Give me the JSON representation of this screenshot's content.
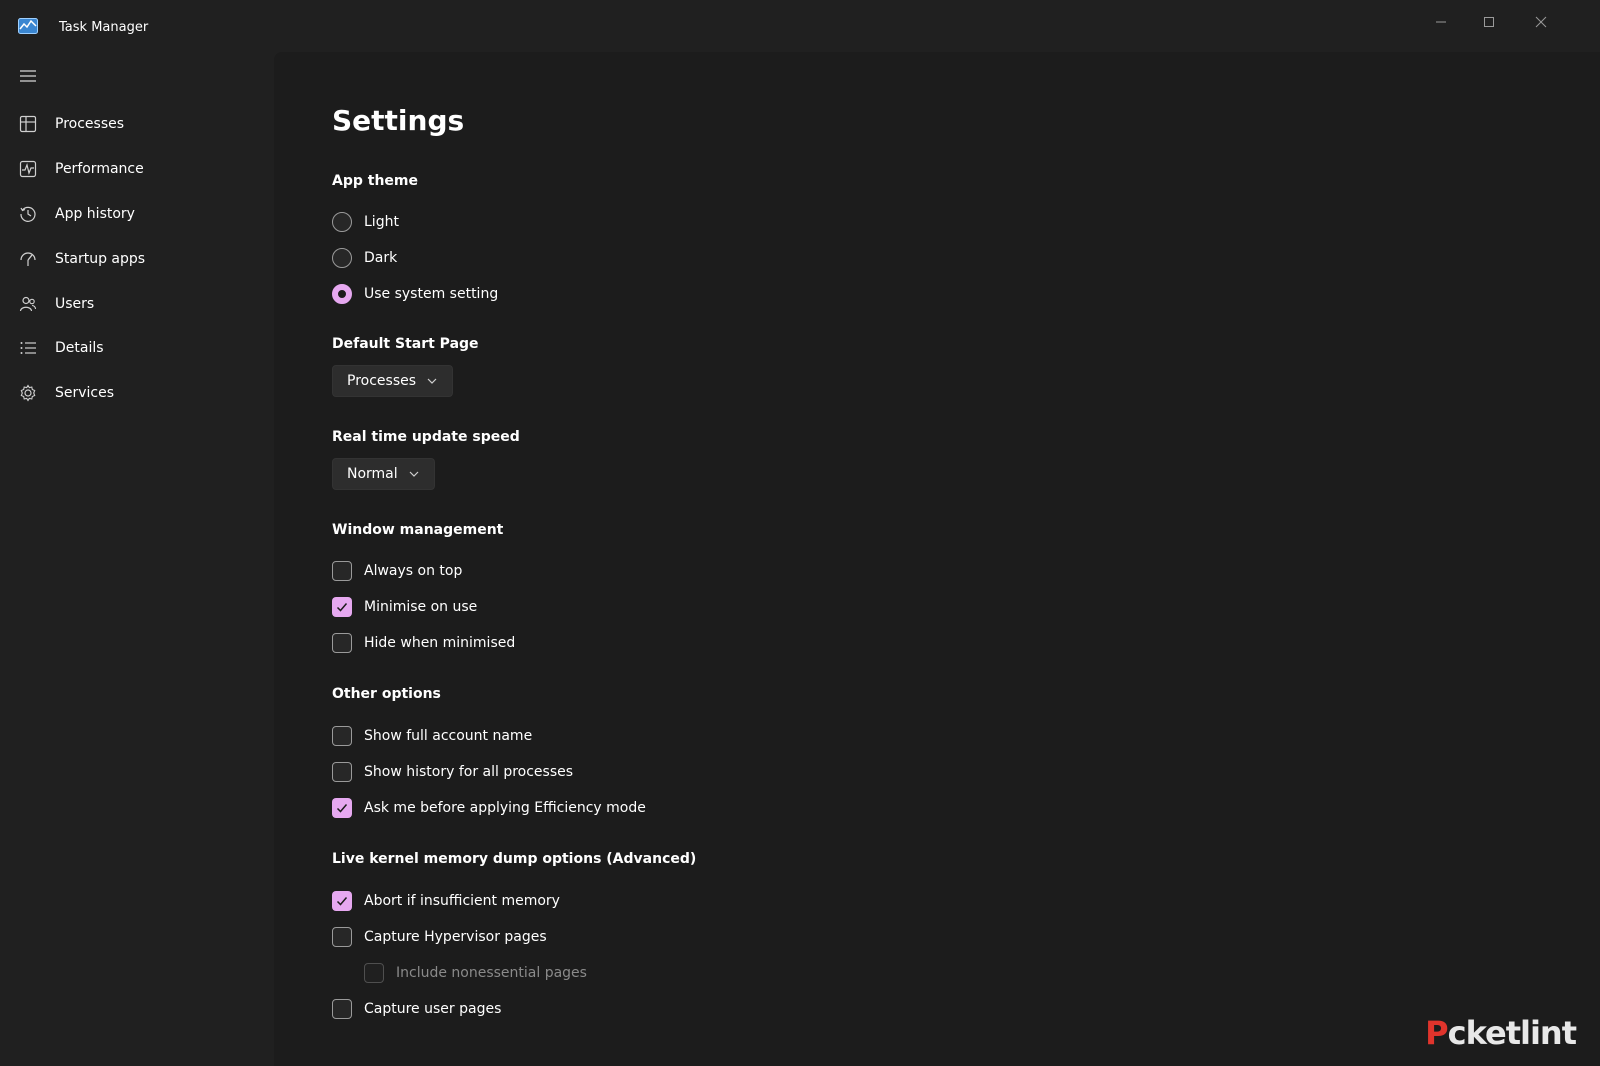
{
  "window": {
    "title": "Task Manager"
  },
  "sidebar": {
    "items": [
      {
        "label": "Processes",
        "icon": "processes-icon"
      },
      {
        "label": "Performance",
        "icon": "performance-icon"
      },
      {
        "label": "App history",
        "icon": "app-history-icon"
      },
      {
        "label": "Startup apps",
        "icon": "startup-apps-icon"
      },
      {
        "label": "Users",
        "icon": "users-icon"
      },
      {
        "label": "Details",
        "icon": "details-icon"
      },
      {
        "label": "Services",
        "icon": "services-icon"
      }
    ]
  },
  "settings": {
    "title": "Settings",
    "app_theme": {
      "heading": "App theme",
      "options": [
        {
          "label": "Light",
          "selected": false
        },
        {
          "label": "Dark",
          "selected": false
        },
        {
          "label": "Use system setting",
          "selected": true
        }
      ]
    },
    "default_start_page": {
      "heading": "Default Start Page",
      "value": "Processes"
    },
    "update_speed": {
      "heading": "Real time update speed",
      "value": "Normal"
    },
    "window_management": {
      "heading": "Window management",
      "options": [
        {
          "label": "Always on top",
          "checked": false
        },
        {
          "label": "Minimise on use",
          "checked": true
        },
        {
          "label": "Hide when minimised",
          "checked": false
        }
      ]
    },
    "other_options": {
      "heading": "Other options",
      "options": [
        {
          "label": "Show full account name",
          "checked": false
        },
        {
          "label": "Show history for all processes",
          "checked": false
        },
        {
          "label": "Ask me before applying Efficiency mode",
          "checked": true
        }
      ]
    },
    "kernel_dump": {
      "heading": "Live kernel memory dump options (Advanced)",
      "options": [
        {
          "label": "Abort if insufficient memory",
          "checked": true
        },
        {
          "label": "Capture Hypervisor pages",
          "checked": false
        },
        {
          "label": "Include nonessential pages",
          "checked": false,
          "disabled": true
        },
        {
          "label": "Capture user pages",
          "checked": false
        }
      ]
    }
  },
  "watermark": {
    "text_accent": "P",
    "text_rest": "cketlint"
  },
  "colors": {
    "accent": "#e6a8f0",
    "background": "#202020",
    "content_bg": "#1c1c1c",
    "watermark_red": "#e0342c"
  }
}
